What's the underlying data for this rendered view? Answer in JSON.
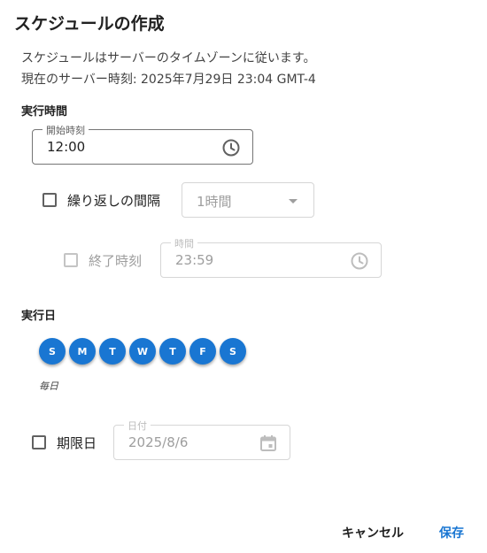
{
  "dialog": {
    "title": "スケジュールの作成",
    "info_line1": "スケジュールはサーバーのタイムゾーンに従います。",
    "info_line2": "現在のサーバー時刻: 2025年7月29日 23:04 GMT-4"
  },
  "execution_time": {
    "section_label": "実行時間",
    "start_time": {
      "label": "開始時刻",
      "value": "12:00",
      "icon": "clock-icon"
    },
    "repeat": {
      "label": "繰り返しの間隔",
      "checked": false,
      "interval_value": "1時間"
    },
    "end_time": {
      "checkbox_label": "終了時刻",
      "checked": false,
      "field_label": "時間",
      "value": "23:59",
      "icon": "clock-icon"
    }
  },
  "execution_day": {
    "section_label": "実行日",
    "days": [
      "S",
      "M",
      "T",
      "W",
      "T",
      "F",
      "S"
    ],
    "summary": "毎日",
    "day_color": "#1976d2"
  },
  "deadline": {
    "checkbox_label": "期限日",
    "checked": false,
    "field_label": "日付",
    "value": "2025/8/6",
    "icon": "calendar-icon"
  },
  "actions": {
    "cancel_label": "キャンセル",
    "save_label": "保存",
    "accent_color": "#1976d2"
  }
}
